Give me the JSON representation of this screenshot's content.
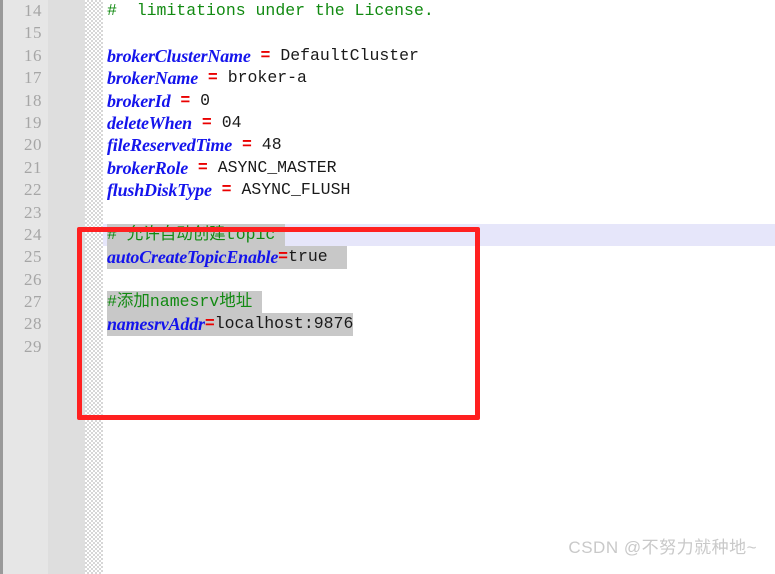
{
  "editor": {
    "first_line_number": 14,
    "gutter_hatch_name": "folding-strip",
    "current_line_number": 24,
    "lines": [
      {
        "num": "14",
        "segments": [
          {
            "text": "#  limitations under the License.",
            "kind": "comment",
            "selected": false
          }
        ]
      },
      {
        "num": "15",
        "segments": []
      },
      {
        "num": "16",
        "segments": [
          {
            "text": "brokerClusterName",
            "kind": "key",
            "selected": false
          },
          {
            "text": " ",
            "kind": "plain",
            "selected": false
          },
          {
            "text": "=",
            "kind": "equals",
            "selected": false
          },
          {
            "text": " DefaultCluster",
            "kind": "value",
            "selected": false
          }
        ]
      },
      {
        "num": "17",
        "segments": [
          {
            "text": "brokerName",
            "kind": "key",
            "selected": false
          },
          {
            "text": " ",
            "kind": "plain",
            "selected": false
          },
          {
            "text": "=",
            "kind": "equals",
            "selected": false
          },
          {
            "text": " broker-a",
            "kind": "value",
            "selected": false
          }
        ]
      },
      {
        "num": "18",
        "segments": [
          {
            "text": "brokerId",
            "kind": "key",
            "selected": false
          },
          {
            "text": " ",
            "kind": "plain",
            "selected": false
          },
          {
            "text": "=",
            "kind": "equals",
            "selected": false
          },
          {
            "text": " 0",
            "kind": "value",
            "selected": false
          }
        ]
      },
      {
        "num": "19",
        "segments": [
          {
            "text": "deleteWhen",
            "kind": "key",
            "selected": false
          },
          {
            "text": " ",
            "kind": "plain",
            "selected": false
          },
          {
            "text": "=",
            "kind": "equals",
            "selected": false
          },
          {
            "text": " 04",
            "kind": "value",
            "selected": false
          }
        ]
      },
      {
        "num": "20",
        "segments": [
          {
            "text": "fileReservedTime",
            "kind": "key",
            "selected": false
          },
          {
            "text": " ",
            "kind": "plain",
            "selected": false
          },
          {
            "text": "=",
            "kind": "equals",
            "selected": false
          },
          {
            "text": " 48",
            "kind": "value",
            "selected": false
          }
        ]
      },
      {
        "num": "21",
        "segments": [
          {
            "text": "brokerRole",
            "kind": "key",
            "selected": false
          },
          {
            "text": " ",
            "kind": "plain",
            "selected": false
          },
          {
            "text": "=",
            "kind": "equals",
            "selected": false
          },
          {
            "text": " ASYNC_MASTER",
            "kind": "value",
            "selected": false
          }
        ]
      },
      {
        "num": "22",
        "segments": [
          {
            "text": "flushDiskType",
            "kind": "key",
            "selected": false
          },
          {
            "text": " ",
            "kind": "plain",
            "selected": false
          },
          {
            "text": "=",
            "kind": "equals",
            "selected": false
          },
          {
            "text": " ASYNC_FLUSH",
            "kind": "value",
            "selected": false
          }
        ]
      },
      {
        "num": "23",
        "segments": []
      },
      {
        "num": "24",
        "current": true,
        "segments": [
          {
            "text": "# 允许自动创建topic ",
            "kind": "comment",
            "selected": true
          }
        ]
      },
      {
        "num": "25",
        "segments": [
          {
            "text": "autoCreateTopicEnable",
            "kind": "key",
            "selected": true
          },
          {
            "text": "=",
            "kind": "equals",
            "selected": true
          },
          {
            "text": "true  ",
            "kind": "value",
            "selected": true
          }
        ]
      },
      {
        "num": "26",
        "segments": []
      },
      {
        "num": "27",
        "segments": [
          {
            "text": "#添加namesrv地址 ",
            "kind": "comment",
            "selected": true
          }
        ]
      },
      {
        "num": "28",
        "segments": [
          {
            "text": "namesrvAddr",
            "kind": "key",
            "selected": true
          },
          {
            "text": "=",
            "kind": "equals",
            "selected": true
          },
          {
            "text": "localhost:9876",
            "kind": "value",
            "selected": true
          }
        ]
      },
      {
        "num": "29",
        "segments": []
      }
    ]
  },
  "annotation": {
    "type": "rectangle-highlight",
    "color": "#ff2020",
    "covers_lines": "24-29"
  },
  "watermark": {
    "text": "CSDN @不努力就种地~"
  },
  "colors": {
    "comment": "#128a12",
    "key": "#1414ec",
    "equals": "#ea0000",
    "value": "#1a1a1a",
    "selection": "#c8c8c8",
    "current_line": "#e6e6fa",
    "gutter": "#e6e6e6",
    "annotation": "#ff2020",
    "watermark": "#c9c9c9"
  }
}
